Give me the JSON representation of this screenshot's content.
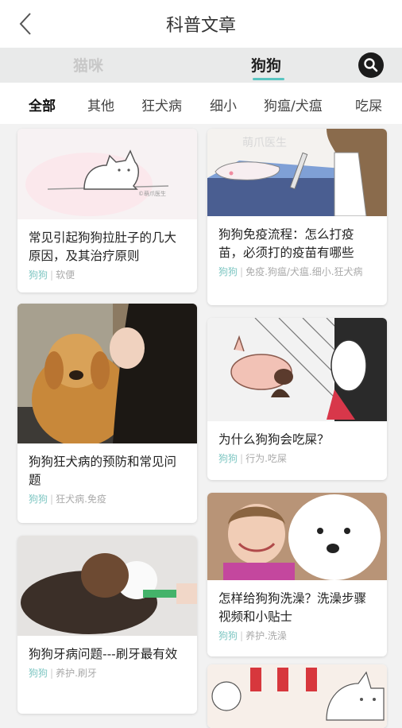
{
  "header": {
    "title": "科普文章"
  },
  "tabs": [
    {
      "label": "猫咪"
    },
    {
      "label": "狗狗"
    }
  ],
  "categories": [
    "全部",
    "其他",
    "狂犬病",
    "细小",
    "狗瘟/犬瘟",
    "吃屎"
  ],
  "articles": [
    {
      "title": "常见引起狗狗拉肚子的几大原因，及其治疗原则",
      "animal": "狗狗",
      "tags": "软便",
      "thumb_text": "©萌爪医生"
    },
    {
      "title": "狗狗免疫流程：怎么打疫苗，必须打的疫苗有哪些",
      "animal": "狗狗",
      "tags": "免疫.狗瘟/犬瘟.细小.狂犬病",
      "thumb_text": "萌爪医生"
    },
    {
      "title": "狗狗狂犬病的预防和常见问题",
      "animal": "狗狗",
      "tags": "狂犬病.免疫"
    },
    {
      "title": "为什么狗狗会吃屎？",
      "animal": "狗狗",
      "tags": "行为.吃屎"
    },
    {
      "title": "狗狗牙病问题---刷牙最有效",
      "animal": "狗狗",
      "tags": "养护.刷牙"
    },
    {
      "title": "怎样给狗狗洗澡？洗澡步骤视频和小贴士",
      "animal": "狗狗",
      "tags": "养护.洗澡"
    }
  ],
  "colors": {
    "accent": "#59c5c1",
    "tag": "#7fc7c3"
  },
  "icons": {
    "back": "chevron-left-icon",
    "search": "search-icon"
  }
}
